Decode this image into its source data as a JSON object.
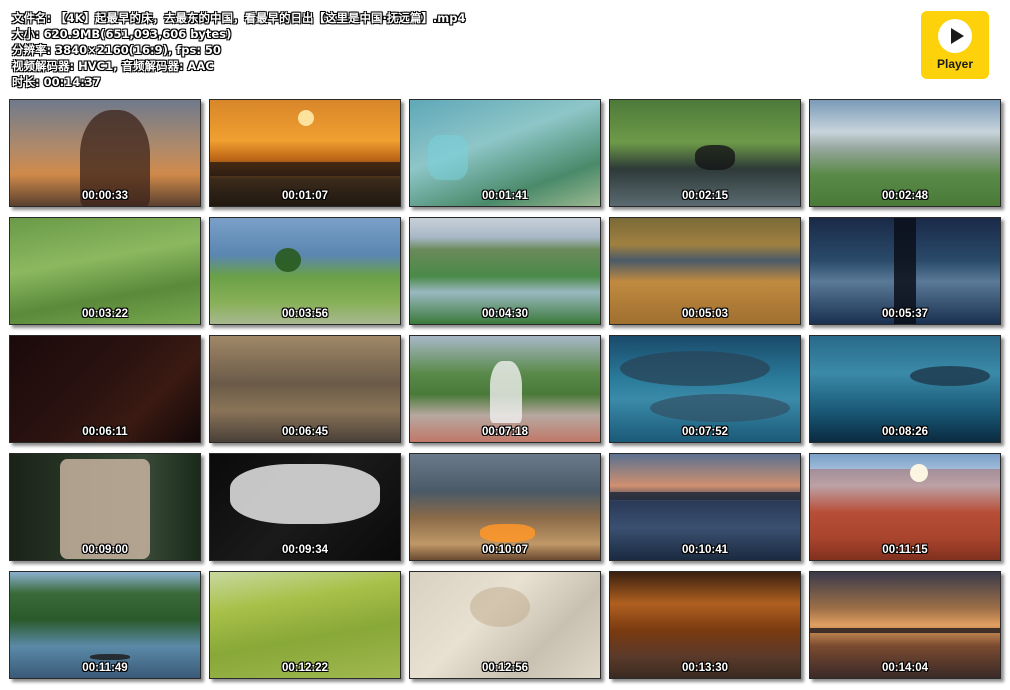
{
  "header": {
    "filename": "文件名: 【4K】起最早的床，去最东的中国，看最早的日出【这里是中国·抚远篇】.mp4",
    "size": "大小: 620.9MB(651,093,606 bytes)",
    "resolution": "分辨率: 3840×2160(16:9), fps: 50",
    "codecs": "视频解码器: HVC1, 音频解码器: AAC",
    "duration": "时长: 00:14:37"
  },
  "player": {
    "label": "Player",
    "bg": "#fdd20a"
  },
  "thumbnails": [
    {
      "time": "00:00:33",
      "bg": "linear-gradient(180deg,#6f7a8c 0%,#b08a6a 45%,#d08a4a 70%,#5a4030 100%)"
    },
    {
      "time": "00:01:07",
      "bg": "linear-gradient(180deg,#d8862a 0%,#f0a030 38%,#c06818 55%,#3a2a1a 75%,#201810 100%)"
    },
    {
      "time": "00:01:41",
      "bg": "linear-gradient(160deg,#5fa8b8 0%,#8ec6c8 40%,#4a8a6a 75%,#9ab890 100%)"
    },
    {
      "time": "00:02:15",
      "bg": "linear-gradient(180deg,#4e7a3a 0%,#6d9a48 40%,#2e3a38 65%,#5a6a70 100%)"
    },
    {
      "time": "00:02:48",
      "bg": "linear-gradient(180deg,#7a9ab8 0%,#c8d4dc 30%,#98a8a0 45%,#5a8a48 70%,#4a7a38 100%)"
    },
    {
      "time": "00:03:22",
      "bg": "linear-gradient(170deg,#6a9a48 0%,#8cb860 40%,#5a8a3a 70%,#7aa850 100%)"
    },
    {
      "time": "00:03:56",
      "bg": "linear-gradient(180deg,#7aa0c8 0%,#5a86b0 35%,#6aa048 55%,#88b058 80%,#a8b890 100%)"
    },
    {
      "time": "00:04:30",
      "bg": "linear-gradient(180deg,#c8d0d8 0%,#a8b8c8 18%,#6a8a5a 30%,#4a8a48 55%,#9ab8c0 70%,#3a7a3a 100%)"
    },
    {
      "time": "00:05:03",
      "bg": "linear-gradient(180deg,#7a6a38 0%,#a08040 25%,#4a5a68 40%,#c08a40 60%,#a07030 100%)"
    },
    {
      "time": "00:05:37",
      "bg": "linear-gradient(180deg,#1a2a48 0%,#2a4a6a 40%,#5a7a98 60%,#1a3050 100%)"
    },
    {
      "time": "00:06:11",
      "bg": "linear-gradient(135deg,#1a0a0a 0%,#2a1210 45%,#3a1a12 70%,#120808 100%)"
    },
    {
      "time": "00:06:45",
      "bg": "linear-gradient(180deg,#a08868 0%,#6a5a48 45%,#8a7458 70%,#4a4038 100%)"
    },
    {
      "time": "00:07:18",
      "bg": "linear-gradient(180deg,#a8b8c8 0%,#5a8a4a 35%,#4a7a3a 55%,#b8a8a0 75%,#c07868 100%)"
    },
    {
      "time": "00:07:52",
      "bg": "linear-gradient(180deg,#1a4a6a 0%,#2a7a9a 40%,#3a8aa8 60%,#1a5a78 100%)"
    },
    {
      "time": "00:08:26",
      "bg": "linear-gradient(180deg,#2a6a8a 0%,#3a8aa8 35%,#1a5a78 70%,#0a2a40 100%)"
    },
    {
      "time": "00:09:00",
      "bg": "linear-gradient(90deg,#1a2218 0%,#2a3a28 40%,#3a4a38 70%,#1a2a1a 100%)"
    },
    {
      "time": "00:09:34",
      "bg": "linear-gradient(135deg,#0a0a0a 0%,#1a1a1a 50%,#0a0a0a 100%)"
    },
    {
      "time": "00:10:07",
      "bg": "linear-gradient(180deg,#6a7a8a 0%,#4a5a68 35%,#8a6a48 60%,#c09868 85%,#6a4a30 100%)"
    },
    {
      "time": "00:10:41",
      "bg": "linear-gradient(180deg,#5a7090 0%,#d09070 30%,#2a3a58 45%,#3a5070 70%,#1a2a40 100%)"
    },
    {
      "time": "00:11:15",
      "bg": "linear-gradient(180deg,#7aa0c8 0%,#c8d8e8 30%,#c05840 55%,#a84830 80%,#6a2a1a 100%)"
    },
    {
      "time": "00:11:49",
      "bg": "linear-gradient(180deg,#8ab0d0 0%,#3a6a3a 20%,#2a5a2a 45%,#5a8aa8 70%,#3a5a78 100%)"
    },
    {
      "time": "00:12:22",
      "bg": "linear-gradient(170deg,#c8d8a0 0%,#a8c048 30%,#88a838 60%,#a0b850 100%)"
    },
    {
      "time": "00:12:56",
      "bg": "linear-gradient(135deg,#d8d0c0 0%,#e8e0d0 40%,#c8c0b0 70%,#e0d8c8 100%)"
    },
    {
      "time": "00:13:30",
      "bg": "linear-gradient(180deg,#3a2010 0%,#b06020 30%,#7a3a10 55%,#5a3a2a 80%,#3a2a20 100%)"
    },
    {
      "time": "00:14:04",
      "bg": "linear-gradient(180deg,#3a3a4a 0%,#a07048 35%,#e0a060 50%,#7a4a30 70%,#3a2a28 100%)"
    }
  ]
}
